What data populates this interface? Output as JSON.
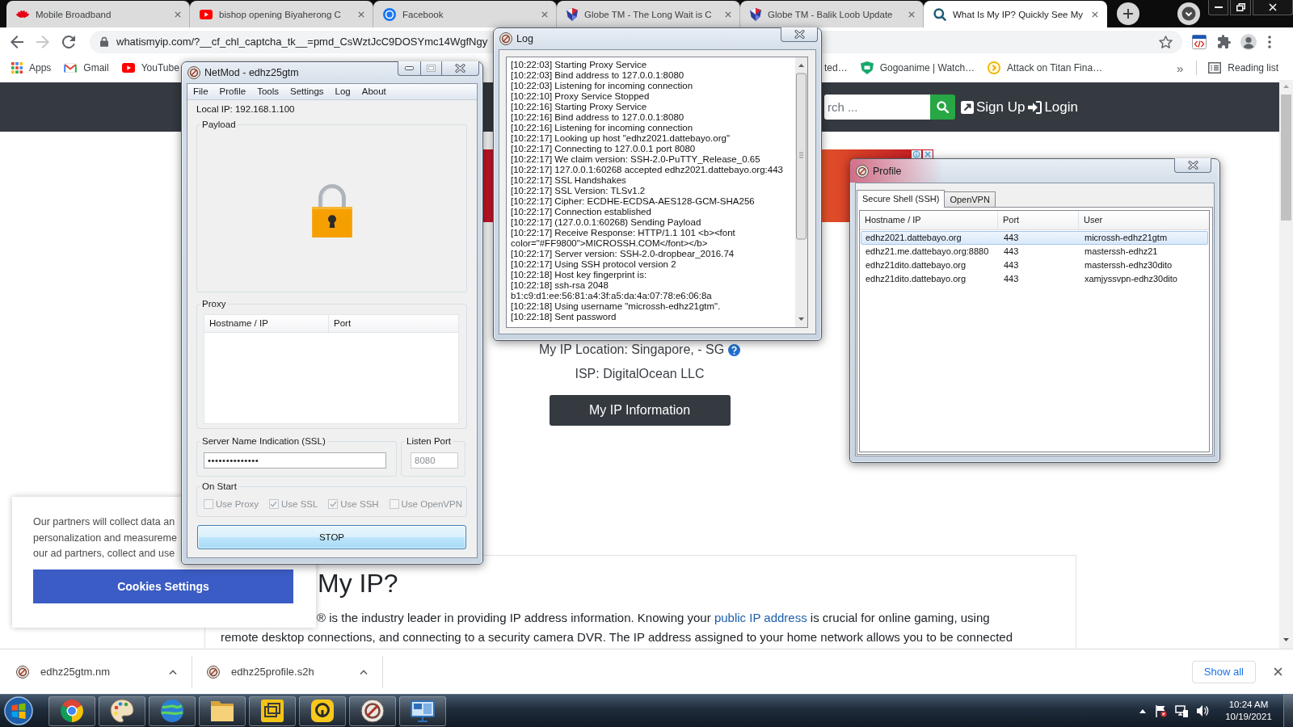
{
  "browser": {
    "tabs": [
      {
        "title": "Mobile Broadband",
        "selected": false
      },
      {
        "title": "bishop opening Biyaherong C",
        "selected": false
      },
      {
        "title": "Facebook",
        "selected": false
      },
      {
        "title": "Globe TM - The Long Wait is C",
        "selected": false
      },
      {
        "title": "Globe TM - Balik Loob Update",
        "selected": false
      },
      {
        "title": "What Is My IP? Quickly See My",
        "selected": true
      }
    ],
    "forward_disabled": true,
    "url": "whatismyip.com/?__cf_chl_captcha_tk__=pmd_CsWztJcC9DOSYmc14WgfNgy",
    "bookmarks": [
      {
        "label": "Apps"
      },
      {
        "label": "Gmail"
      },
      {
        "label": "YouTube"
      },
      {
        "label": "ted…"
      },
      {
        "label": "Gogoanime | Watch…"
      },
      {
        "label": "Attack on Titan Fina…"
      }
    ],
    "more_bookmarks": "»",
    "reading_list": "Reading list"
  },
  "page": {
    "search": {
      "placeholder": "rch ..."
    },
    "nav_links": [
      "Sign Up",
      "Login"
    ],
    "location": "My IP Location: Singapore, - SG",
    "isp": "ISP: DigitalOcean LLC",
    "info_button": "My IP Information",
    "article": {
      "heading": "My IP?",
      "lines": [
        [
          {
            "kind": "text",
            "text": "® is the industry leader in providing IP address information. Knowing your "
          },
          {
            "kind": "link",
            "text": "public IP address"
          },
          {
            "kind": "text",
            "text": " is crucial for online gaming, using"
          }
        ],
        [
          {
            "kind": "text",
            "text": "remote desktop connections, and connecting to a security camera DVR. The IP address assigned to your home network allows you to be connected"
          }
        ]
      ]
    }
  },
  "cookie_banner": {
    "lines": [
      "Our partners will collect data an",
      "personalization and measureme",
      "our ad partners, collect and use"
    ],
    "button": "Cookies Settings"
  },
  "netmod": {
    "title": "NetMod - edhz25gtm",
    "maximize_disabled": true,
    "menu": [
      "File",
      "Profile",
      "Tools",
      "Settings",
      "Log",
      "About"
    ],
    "local_ip": "Local IP: 192.168.1.100",
    "payload": {
      "label": "Payload"
    },
    "proxy": {
      "label": "Proxy",
      "columns": [
        "Hostname / IP",
        "Port"
      ]
    },
    "sni": {
      "label": "Server Name Indication (SSL)",
      "value": "••••••••••••••"
    },
    "listen_port": {
      "label": "Listen Port",
      "value": "8080",
      "disabled": true
    },
    "on_start": {
      "label": "On Start",
      "options": [
        {
          "label": "Use Proxy",
          "checked": false,
          "disabled": true
        },
        {
          "label": "Use SSL",
          "checked": true,
          "disabled": true
        },
        {
          "label": "Use SSH",
          "checked": true,
          "disabled": true
        },
        {
          "label": "Use OpenVPN",
          "checked": false,
          "disabled": true
        }
      ]
    },
    "button": "STOP"
  },
  "log": {
    "title": "Log",
    "lines": [
      "[10:22:03] Starting Proxy Service",
      "[10:22:03] Bind address to 127.0.0.1:8080",
      "[10:22:03] Listening for incoming connection",
      "[10:22:10] Proxy Service Stopped",
      "[10:22:16] Starting Proxy Service",
      "[10:22:16] Bind address to 127.0.0.1:8080",
      "[10:22:16] Listening for incoming connection",
      "[10:22:17] Looking up host \"edhz2021.dattebayo.org\"",
      "[10:22:17] Connecting to 127.0.0.1 port 8080",
      "[10:22:17] We claim version: SSH-2.0-PuTTY_Release_0.65",
      "[10:22:17] 127.0.0.1:60268 accepted edhz2021.dattebayo.org:443",
      "[10:22:17] SSL Handshakes",
      "[10:22:17] SSL Version: TLSv1.2",
      "[10:22:17] Cipher: ECDHE-ECDSA-AES128-GCM-SHA256",
      "[10:22:17] Connection established",
      "[10:22:17] (127.0.0.1:60268) Sending Payload",
      "[10:22:17] Receive Response: HTTP/1.1 101 <b><font",
      "color=\"#FF9800\">MICROSSH.COM</font></b>",
      "[10:22:17] Server version: SSH-2.0-dropbear_2016.74",
      "[10:22:17] Using SSH protocol version 2",
      "[10:22:18] Host key fingerprint is:",
      "[10:22:18] ssh-rsa 2048",
      "b1:c9:d1:ee:56:81:a4:3f:a5:da:4a:07:78:e6:06:8a",
      "[10:22:18] Using username \"microssh-edhz21gtm\".",
      "[10:22:18] Sent password"
    ]
  },
  "profile": {
    "title": "Profile",
    "tabs": [
      {
        "label": "Secure Shell (SSH)",
        "selected": true
      },
      {
        "label": "OpenVPN",
        "selected": false
      }
    ],
    "columns": [
      "Hostname / IP",
      "Port",
      "User"
    ],
    "rows": [
      {
        "cells": [
          "edhz2021.dattebayo.org",
          "443",
          "microssh-edhz21gtm"
        ],
        "selected": true
      },
      {
        "cells": [
          "edhz21.me.dattebayo.org:8880",
          "443",
          "masterssh-edhz21"
        ],
        "selected": false
      },
      {
        "cells": [
          "edhz21dito.dattebayo.org",
          "443",
          "masterssh-edhz30dito"
        ],
        "selected": false
      },
      {
        "cells": [
          "edhz21dito.dattebayo.org",
          "443",
          "xamjyssvpn-edhz30dito"
        ],
        "selected": false
      }
    ]
  },
  "downloads": {
    "items": [
      {
        "name": "edhz25gtm.nm"
      },
      {
        "name": "edhz25profile.s2h"
      }
    ],
    "show_all": "Show all"
  },
  "taskbar": {
    "time": "10:24 AM",
    "date": "10/19/2021"
  }
}
